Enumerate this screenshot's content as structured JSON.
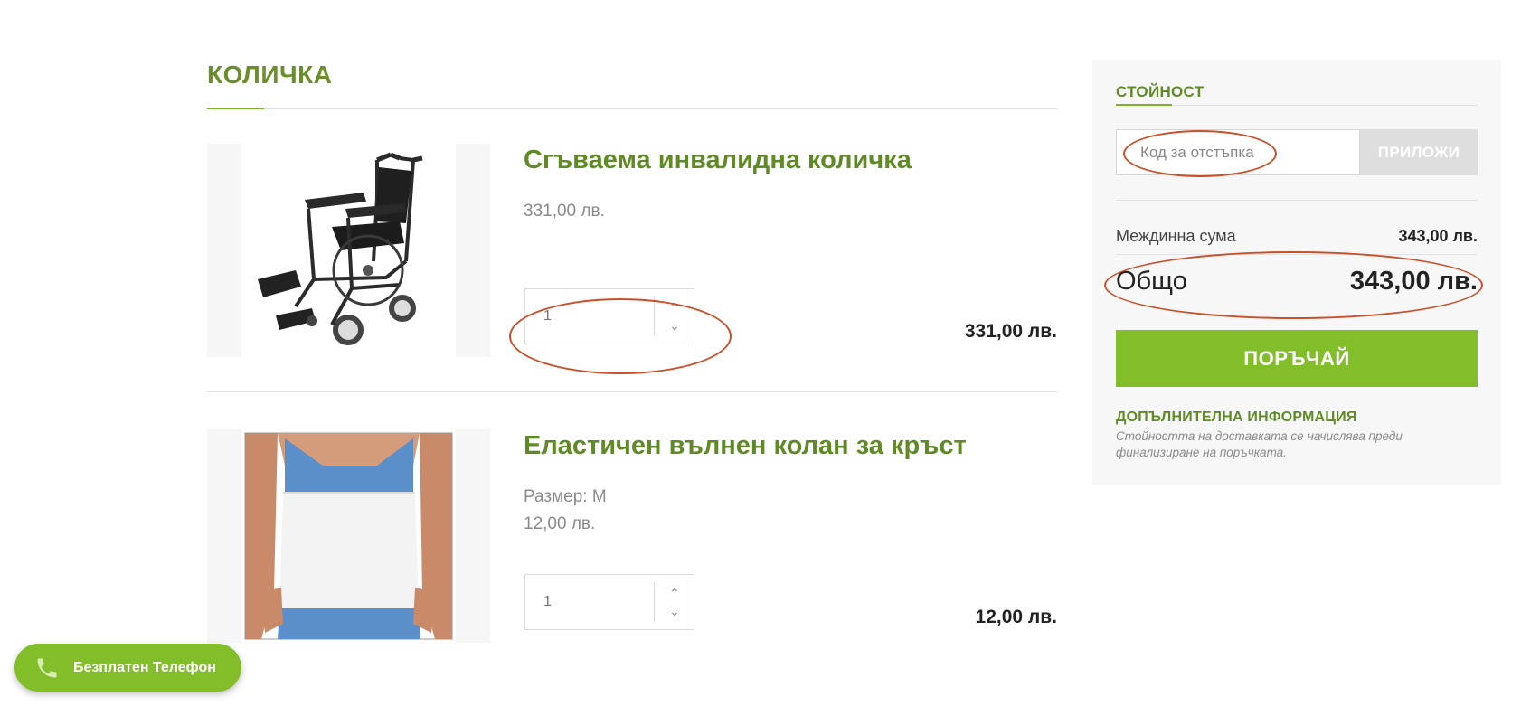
{
  "cart": {
    "title": "КОЛИЧКА",
    "items": [
      {
        "name": "Сгъваема инвалидна количка",
        "unit_price": "331,00 лв.",
        "quantity": "1",
        "line_total": "331,00 лв.",
        "image": "wheelchair-image"
      },
      {
        "name": "Еластичен вълнен колан за кръст",
        "variant": "Размер: M",
        "unit_price": "12,00 лв.",
        "quantity": "1",
        "line_total": "12,00 лв.",
        "image": "back-belt-image"
      }
    ]
  },
  "summary": {
    "title": "СТОЙНОСТ",
    "coupon_placeholder": "Код за отстъпка",
    "apply_label": "ПРИЛОЖИ",
    "subtotal_label": "Междинна сума",
    "subtotal_value": "343,00 лв.",
    "total_label": "Общо",
    "total_value": "343,00 лв.",
    "order_label": "ПОРЪЧАЙ",
    "info_title": "ДОПЪЛНИТЕЛНА ИНФОРМАЦИЯ",
    "info_text": "Стойността на доставката се начислява преди финализиране на поръчката."
  },
  "phone": {
    "label": "Безплатен Телефон",
    "icon": "phone-icon"
  },
  "colors": {
    "accent": "#82bd2a",
    "heading_green": "#5f8a25",
    "annotation": "#c8512a"
  }
}
